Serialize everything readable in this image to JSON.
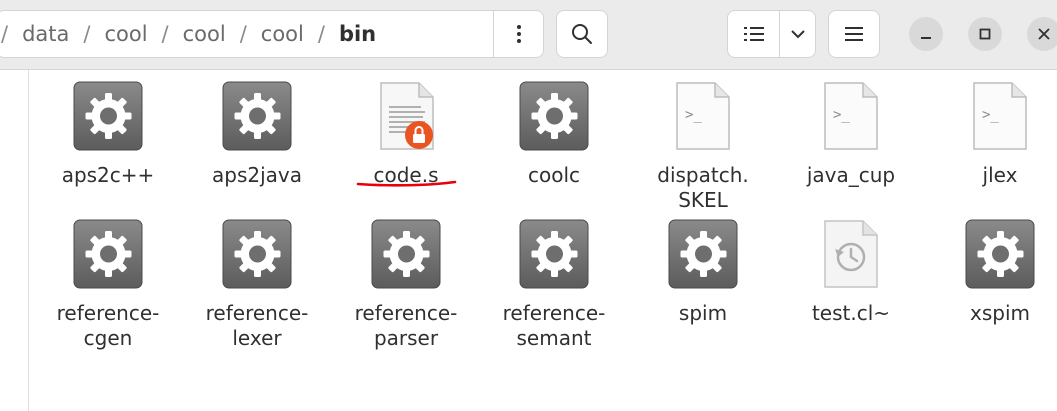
{
  "path": {
    "root_sep": "/",
    "segments": [
      "data",
      "cool",
      "cool",
      "cool",
      "bin"
    ],
    "separator": "/"
  },
  "files": [
    {
      "label": "aps2c++",
      "icon": "gear-executable-icon"
    },
    {
      "label": "aps2java",
      "icon": "gear-executable-icon"
    },
    {
      "label": "code.s",
      "icon": "locked-text-file-icon"
    },
    {
      "label": "coolc",
      "icon": "gear-executable-icon"
    },
    {
      "label": "dispatch.\nSKEL",
      "icon": "script-file-icon"
    },
    {
      "label": "java_cup",
      "icon": "script-file-icon"
    },
    {
      "label": "jlex",
      "icon": "script-file-icon"
    },
    {
      "label": "reference-\ncgen",
      "icon": "gear-executable-icon"
    },
    {
      "label": "reference-\nlexer",
      "icon": "gear-executable-icon"
    },
    {
      "label": "reference-\nparser",
      "icon": "gear-executable-icon"
    },
    {
      "label": "reference-\nsemant",
      "icon": "gear-executable-icon"
    },
    {
      "label": "spim",
      "icon": "gear-executable-icon"
    },
    {
      "label": "test.cl~",
      "icon": "backup-file-icon"
    },
    {
      "label": "xspim",
      "icon": "gear-executable-icon"
    }
  ],
  "colors": {
    "header_bg": "#ebebeb",
    "lock_badge": "#e95420",
    "annotation": "#e8000b"
  }
}
